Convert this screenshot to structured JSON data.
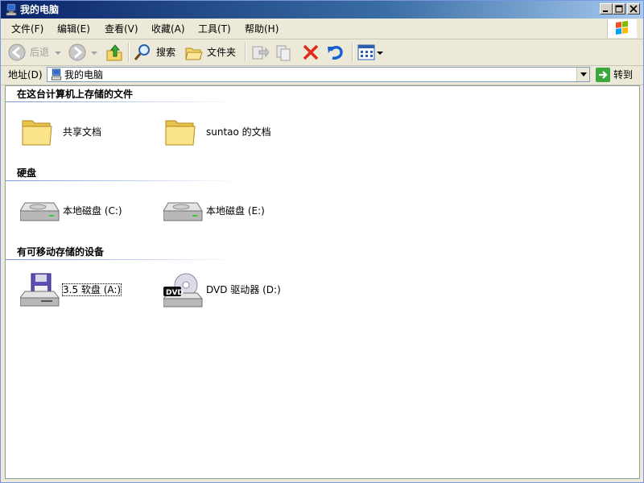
{
  "window": {
    "title": "我的电脑"
  },
  "menubar": {
    "items": [
      "文件(F)",
      "编辑(E)",
      "查看(V)",
      "收藏(A)",
      "工具(T)",
      "帮助(H)"
    ]
  },
  "toolbar": {
    "back_label": "后退",
    "search_label": "搜索",
    "folders_label": "文件夹"
  },
  "addressbar": {
    "label": "地址(D)",
    "value": "我的电脑",
    "go_label": "转到"
  },
  "groups": [
    {
      "header": "在这台计算机上存储的文件",
      "items": [
        {
          "label": "共享文档",
          "icon": "folder-icon"
        },
        {
          "label": "suntao 的文档",
          "icon": "folder-icon"
        }
      ]
    },
    {
      "header": "硬盘",
      "items": [
        {
          "label": "本地磁盘 (C:)",
          "icon": "hard-disk-icon"
        },
        {
          "label": "本地磁盘 (E:)",
          "icon": "hard-disk-icon"
        }
      ]
    },
    {
      "header": "有可移动存储的设备",
      "items": [
        {
          "label": "3.5 软盘 (A:)",
          "icon": "floppy-drive-icon"
        },
        {
          "label": "DVD 驱动器 (D:)",
          "icon": "dvd-drive-icon"
        }
      ]
    }
  ],
  "colors": {
    "titlebar_start": "#0a246a",
    "titlebar_end": "#a6caf0",
    "window_bg": "#ece9d8",
    "content_bg": "#ffffff"
  }
}
